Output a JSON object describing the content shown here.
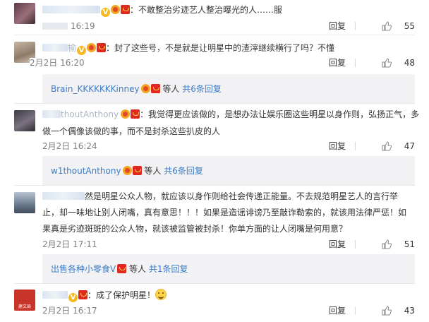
{
  "comments": [
    {
      "username": "",
      "text": "：不敢整治劣迹艺人整治曝光的人……服",
      "time": "16:19",
      "reply": "回复",
      "likes": "55"
    },
    {
      "username": "榆",
      "text": "：封了这些号，不是就是让明星中的渣滓继续横行了吗？不懂",
      "time": "2月2日 16:20",
      "reply": "回复",
      "likes": "48",
      "sub": {
        "user": "Brain_KKKKKKKinney",
        "suffix": "等人",
        "total": "共6条回复"
      }
    },
    {
      "username": "thoutAnthony",
      "text_line1": "：我觉得更应该做的，是想办法让娱乐圈这些明星以身作则，弘扬正气，多",
      "text_line2": "做一个偶像该做的事，而不是封杀这些扒皮的人",
      "time": "2月2日 16:24",
      "reply": "回复",
      "likes": "47",
      "sub": {
        "user": "w1thoutAnthony",
        "suffix": "等人",
        "total": "共6条回复"
      }
    },
    {
      "text_line1": "然是明星公众人物，就应该以身作则给社会传递正能量。不去规范明星艺人的言行举",
      "text_line2": "止，却一味地让别人闭嘴，真有意思！！！如果是造谣诽谤乃至敲诈勒索的，就该用法律严惩！如",
      "text_line3": "果真是劣迹斑斑的公众人物，就该被监管被封杀！你单方面的让人闭嘴是何用意？",
      "time": "2月2日 17:11",
      "reply": "回复",
      "likes": "51",
      "sub": {
        "user": "出售各种小零食V",
        "suffix": "等人",
        "total": "共1条回复"
      }
    },
    {
      "text": "：成了保护明星！",
      "time": "2月2日 16:17",
      "reply": "回复",
      "likes": "43",
      "avatar_label": "建文局"
    }
  ],
  "colors": {
    "link": "#3b7bc4",
    "reply_bg": "#f2f2f5",
    "meta": "#808080"
  },
  "icons": [
    "verified-v-icon",
    "fan-badge-icon",
    "member-badge-icon",
    "thumb-up-icon",
    "smile-emoji-icon"
  ]
}
